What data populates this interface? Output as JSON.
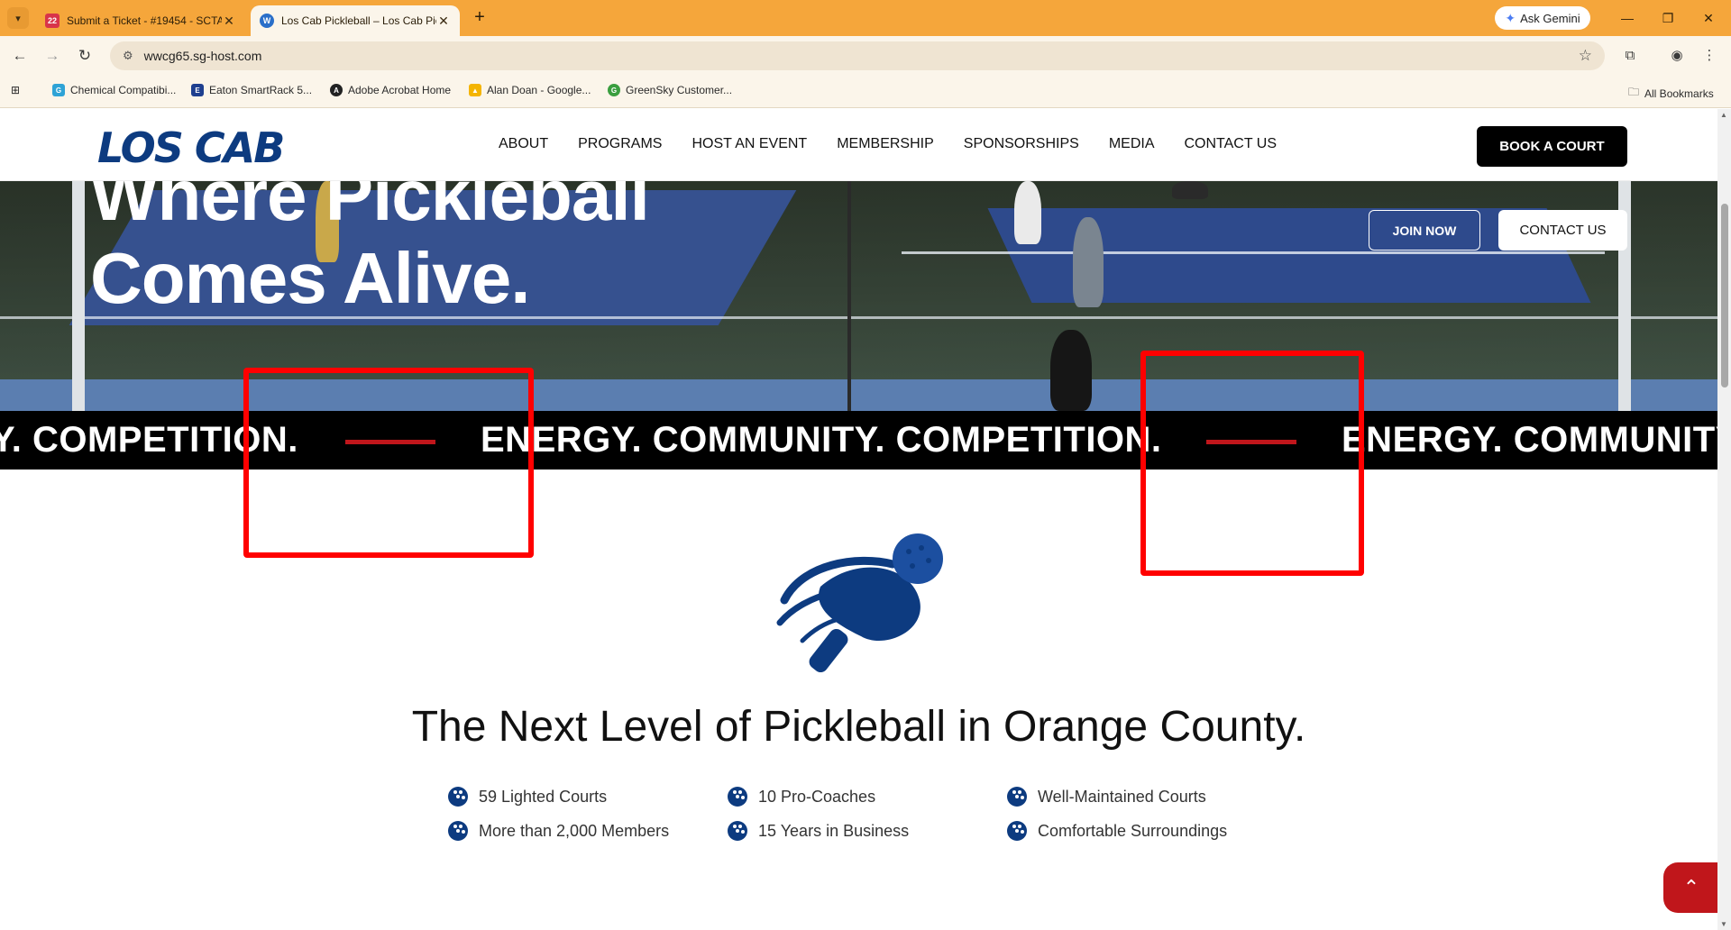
{
  "browser": {
    "tabs": [
      {
        "title": "Submit a Ticket - #19454 - SCTA",
        "favicon": "22",
        "active": false
      },
      {
        "title": "Los Cab Pickleball – Los Cab Pickleball",
        "favicon": "W",
        "active": true
      }
    ],
    "address": "wwcg65.sg-host.com",
    "gemini_label": "Ask Gemini",
    "bookmarks": [
      "Chemical Compatibi...",
      "Eaton SmartRack 5...",
      "Adobe Acrobat Home",
      "Alan Doan - Google...",
      "GreenSky Customer..."
    ],
    "all_bookmarks": "All Bookmarks"
  },
  "site": {
    "logo": "LOS CAB",
    "nav": [
      "ABOUT",
      "PROGRAMS",
      "HOST AN EVENT",
      "MEMBERSHIP",
      "SPONSORSHIPS",
      "MEDIA",
      "CONTACT US"
    ],
    "book_button": "BOOK A COURT"
  },
  "hero": {
    "title_line1": "Where Pickleball",
    "title_line2": "Comes Alive.",
    "join_button": "JOIN NOW",
    "contact_button": "CONTACT US"
  },
  "marquee": {
    "segment1": "Y. COMPETITION.",
    "segment2": "ENERGY. COMMUNITY. COMPETITION.",
    "segment3": "ENERGY. COMMUNITY"
  },
  "content": {
    "tagline": "The Next Level of Pickleball in Orange County.",
    "features": [
      "59 Lighted Courts",
      "10 Pro-Coaches",
      "Well-Maintained Courts",
      "More than 2,000 Members",
      "15 Years in Business",
      "Comfortable Surroundings"
    ]
  },
  "colors": {
    "brand_blue": "#0d3b80",
    "accent_red": "#c0161b",
    "chrome_orange": "#f5a63b"
  }
}
